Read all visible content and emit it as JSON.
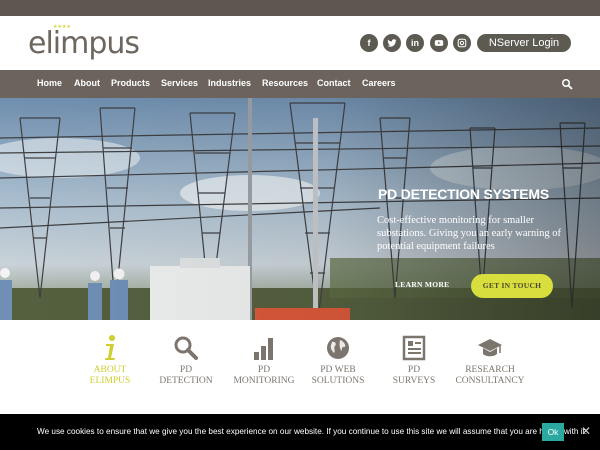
{
  "brand": {
    "logo_text": "elimpus",
    "stars": "★★★★"
  },
  "header": {
    "social": [
      {
        "name": "facebook",
        "glyph": "f"
      },
      {
        "name": "twitter",
        "glyph": "t"
      },
      {
        "name": "linkedin",
        "glyph": "in"
      },
      {
        "name": "youtube",
        "glyph": "▶"
      },
      {
        "name": "instagram",
        "glyph": "◙"
      }
    ],
    "login_label": "NServer Login"
  },
  "nav": {
    "items": [
      "Home",
      "About",
      "Products",
      "Services",
      "Industries",
      "Resources",
      "Contact",
      "Careers"
    ],
    "search_icon": "search-icon"
  },
  "hero": {
    "title": "PD DETECTION SYSTEMS",
    "text": "Cost-effective monitoring for smaller substations. Giving you an early warning of potential equipment failures",
    "learn_more": "LEARN MORE",
    "get_in_touch": "GET IN TOUCH"
  },
  "features": [
    {
      "label": "ABOUT\nELIMPUS",
      "icon": "info-icon",
      "active": true
    },
    {
      "label": "PD\nDETECTION",
      "icon": "search-icon",
      "active": false
    },
    {
      "label": "PD\nMONITORING",
      "icon": "bar-chart-icon",
      "active": false
    },
    {
      "label": "PD WEB\nSOLUTIONS",
      "icon": "globe-icon",
      "active": false
    },
    {
      "label": "PD\nSURVEYS",
      "icon": "document-icon",
      "active": false
    },
    {
      "label": "RESEARCH\nCONSULTANCY",
      "icon": "graduation-cap-icon",
      "active": false
    }
  ],
  "cookie": {
    "text": "We use cookies to ensure that we give you the best experience on our website. If you continue to use this site we will assume that you are happy with it.",
    "ok_label": "Ok",
    "close_glyph": "✕"
  },
  "colors": {
    "topbar": "#5e574f",
    "nav": "#6c645c",
    "accent": "#d8de3d",
    "cookie_ok": "#2ba89f"
  }
}
